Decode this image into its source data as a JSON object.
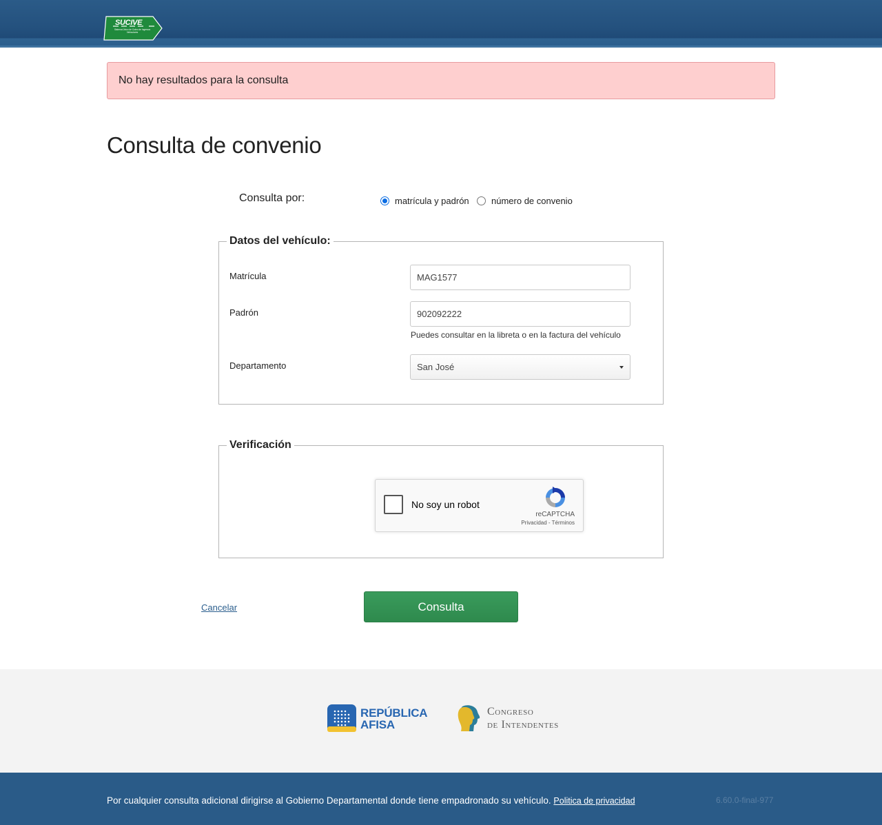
{
  "header": {
    "logo_text": "SUCIVE",
    "logo_subtitle": "Sistema Único de Cobro de Ingresos Vehiculares"
  },
  "alert": {
    "message": "No hay resultados para la consulta"
  },
  "page_title": "Consulta de convenio",
  "consulta_por": {
    "label": "Consulta por:",
    "options": [
      {
        "label": "matrícula y padrón",
        "checked": true
      },
      {
        "label": "número de convenio",
        "checked": false
      }
    ]
  },
  "vehicle_data": {
    "legend": "Datos del vehículo:",
    "matricula_label": "Matrícula",
    "matricula_value": "MAG1577",
    "padron_label": "Padrón",
    "padron_value": "902092222",
    "padron_help": "Puedes consultar en la libreta o en la factura del vehículo",
    "departamento_label": "Departamento",
    "departamento_value": "San José"
  },
  "verification": {
    "legend": "Verificación",
    "captcha_label": "No soy un robot",
    "captcha_brand": "reCAPTCHA",
    "captcha_privacy": "Privacidad",
    "captcha_separator": " - ",
    "captcha_terms": "Términos"
  },
  "actions": {
    "cancel_label": "Cancelar",
    "submit_label": "Consulta"
  },
  "partners": {
    "afisa_line1": "REPÚBLICA",
    "afisa_line2": "AFISA",
    "congreso_line1": "Congreso",
    "congreso_line2": "de Intendentes"
  },
  "footer": {
    "text": "Por cualquier consulta adicional dirigirse al Gobierno Departamental donde tiene empadronado su vehículo. ",
    "privacy_link": "Politica de privacidad",
    "version": "6.60.0-final-977"
  },
  "colors": {
    "header_bg": "#2a5b88",
    "alert_bg": "#fecfcf",
    "submit_bg": "#2e8a4d",
    "link": "#2c5f8e"
  }
}
